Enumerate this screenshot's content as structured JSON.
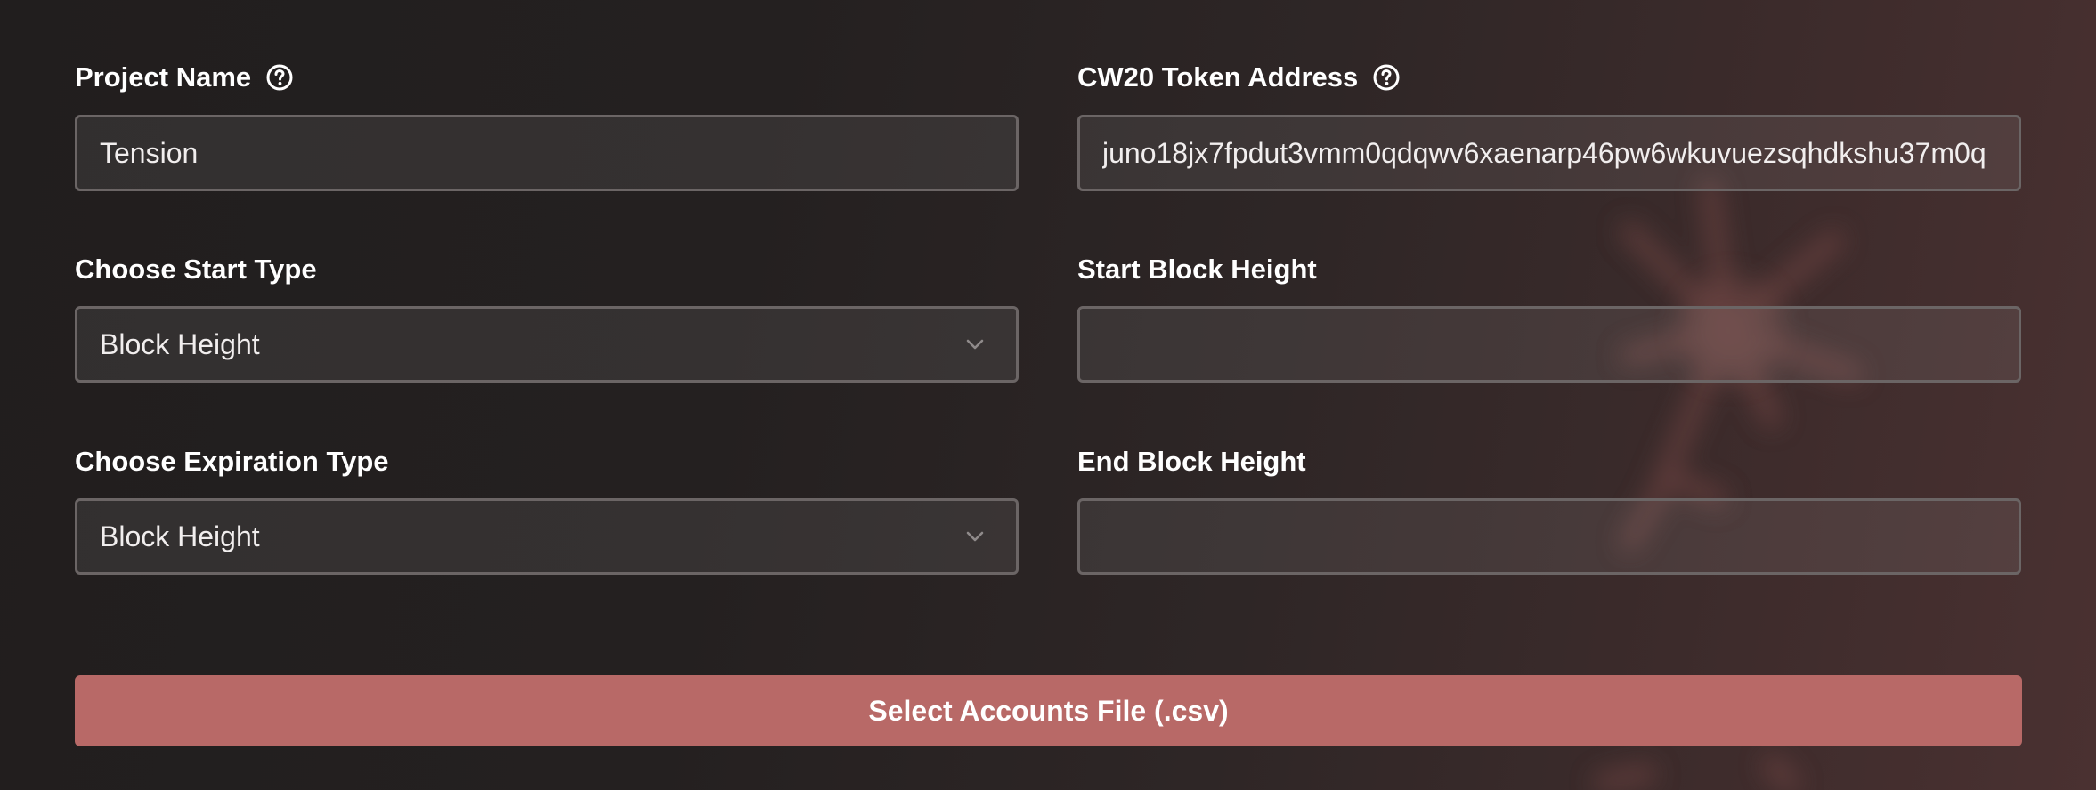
{
  "form": {
    "project_name": {
      "label": "Project Name",
      "value": "Tension",
      "help_icon": "question-circle-icon"
    },
    "token_address": {
      "label": "CW20 Token Address",
      "value": "juno18jx7fpdut3vmm0qdqwv6xaenarp46pw6wkuvuezsqhdkshu37m0q",
      "help_icon": "question-circle-icon"
    },
    "start_type": {
      "label": "Choose Start Type",
      "selected": "Block Height",
      "icon": "chevron-down-icon"
    },
    "start_block_height": {
      "label": "Start Block Height",
      "value": ""
    },
    "expiration_type": {
      "label": "Choose Expiration Type",
      "selected": "Block Height",
      "icon": "chevron-down-icon"
    },
    "end_block_height": {
      "label": "End Block Height",
      "value": ""
    },
    "select_file_button": {
      "label": "Select Accounts File (.csv)"
    }
  },
  "colors": {
    "button_bg": "#b86967",
    "field_border": "#6b6565",
    "background": "#242020"
  }
}
